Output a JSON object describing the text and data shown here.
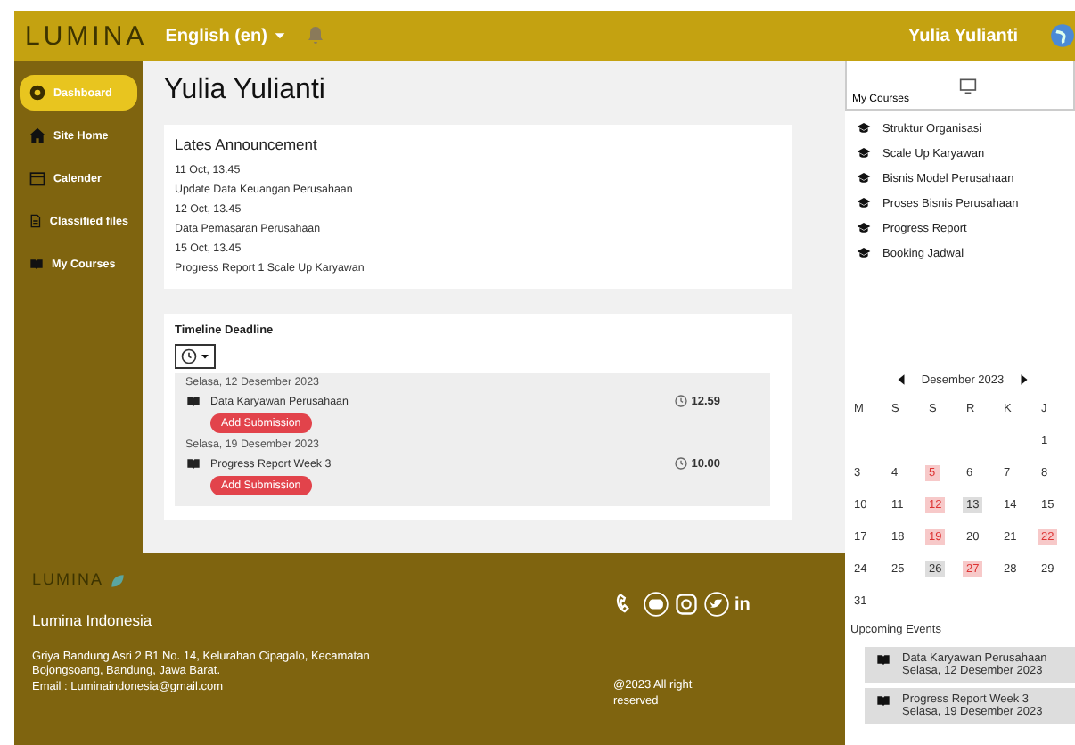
{
  "header": {
    "logo": "LUMINA",
    "language": "English (en)",
    "user": "Yulia Yulianti"
  },
  "sidebar": {
    "items": [
      {
        "label": "Dashboard",
        "selected": true
      },
      {
        "label": "Site Home",
        "selected": false
      },
      {
        "label": "Calender",
        "selected": false
      },
      {
        "label": "Classified files",
        "selected": false
      },
      {
        "label": "My Courses",
        "selected": false
      }
    ]
  },
  "page_title": "Yulia Yulianti",
  "announcements": {
    "title": "Lates Announcement",
    "items": [
      {
        "date": "11 Oct, 13.45",
        "text": "Update Data Keuangan Perusahaan"
      },
      {
        "date": "12 Oct, 13.45",
        "text": "Data Pemasaran Perusahaan"
      },
      {
        "date": "15 Oct, 13.45",
        "text": "Progress Report 1 Scale Up Karyawan"
      }
    ]
  },
  "timeline": {
    "title": "Timeline Deadline",
    "items": [
      {
        "date": "Selasa, 12 Desember 2023",
        "name": "Data Karyawan Perusahaan",
        "time": "12.59",
        "action": "Add Submission"
      },
      {
        "date": "Selasa, 19 Desember 2023",
        "name": "Progress Report Week 3",
        "time": "10.00",
        "action": "Add Submission"
      }
    ]
  },
  "my_courses": {
    "title": "My Courses",
    "items": [
      "Struktur Organisasi",
      "Scale Up Karyawan",
      "Bisnis Model Perusahaan",
      "Proses Bisnis Perusahaan",
      "Progress Report",
      "Booking Jadwal"
    ]
  },
  "calendar": {
    "month": "Desember 2023",
    "weekdays": [
      "M",
      "S",
      "S",
      "R",
      "K",
      "J"
    ],
    "days": [
      {
        "kind": "blank"
      },
      {
        "kind": "blank"
      },
      {
        "kind": "blank"
      },
      {
        "kind": "blank"
      },
      {
        "kind": "blank"
      },
      {
        "day": "1",
        "kind": "plain"
      },
      {
        "day": "3",
        "kind": "plain"
      },
      {
        "day": "4",
        "kind": "plain"
      },
      {
        "day": "5",
        "kind": "event"
      },
      {
        "day": "6",
        "kind": "plain"
      },
      {
        "day": "7",
        "kind": "plain"
      },
      {
        "day": "8",
        "kind": "plain"
      },
      {
        "day": "10",
        "kind": "plain"
      },
      {
        "day": "11",
        "kind": "plain"
      },
      {
        "day": "12",
        "kind": "event"
      },
      {
        "day": "13",
        "kind": "grey"
      },
      {
        "day": "14",
        "kind": "plain"
      },
      {
        "day": "15",
        "kind": "plain"
      },
      {
        "day": "17",
        "kind": "plain"
      },
      {
        "day": "18",
        "kind": "plain"
      },
      {
        "day": "19",
        "kind": "event"
      },
      {
        "day": "20",
        "kind": "plain"
      },
      {
        "day": "21",
        "kind": "plain"
      },
      {
        "day": "22",
        "kind": "event"
      },
      {
        "day": "24",
        "kind": "plain"
      },
      {
        "day": "25",
        "kind": "plain"
      },
      {
        "day": "26",
        "kind": "grey"
      },
      {
        "day": "27",
        "kind": "event"
      },
      {
        "day": "28",
        "kind": "plain"
      },
      {
        "day": "29",
        "kind": "plain"
      },
      {
        "day": "31",
        "kind": "plain"
      }
    ]
  },
  "upcoming": {
    "title": "Upcoming Events",
    "items": [
      {
        "name": "Data Karyawan Perusahaan",
        "date": "Selasa, 12 Desember 2023"
      },
      {
        "name": "Progress Report Week 3",
        "date": "Selasa, 19 Desember 2023"
      }
    ]
  },
  "footer": {
    "logo": "LUMINA",
    "company": "Lumina Indonesia",
    "address": "Griya Bandung Asri 2 B1 No. 14, Kelurahan Cipagalo, Kecamatan Bojongsoang, Bandung, Jawa Barat.",
    "email": "Email : Luminaindonesia@gmail.com",
    "linkedin": "in",
    "copyright": "@2023 All right reserved"
  }
}
